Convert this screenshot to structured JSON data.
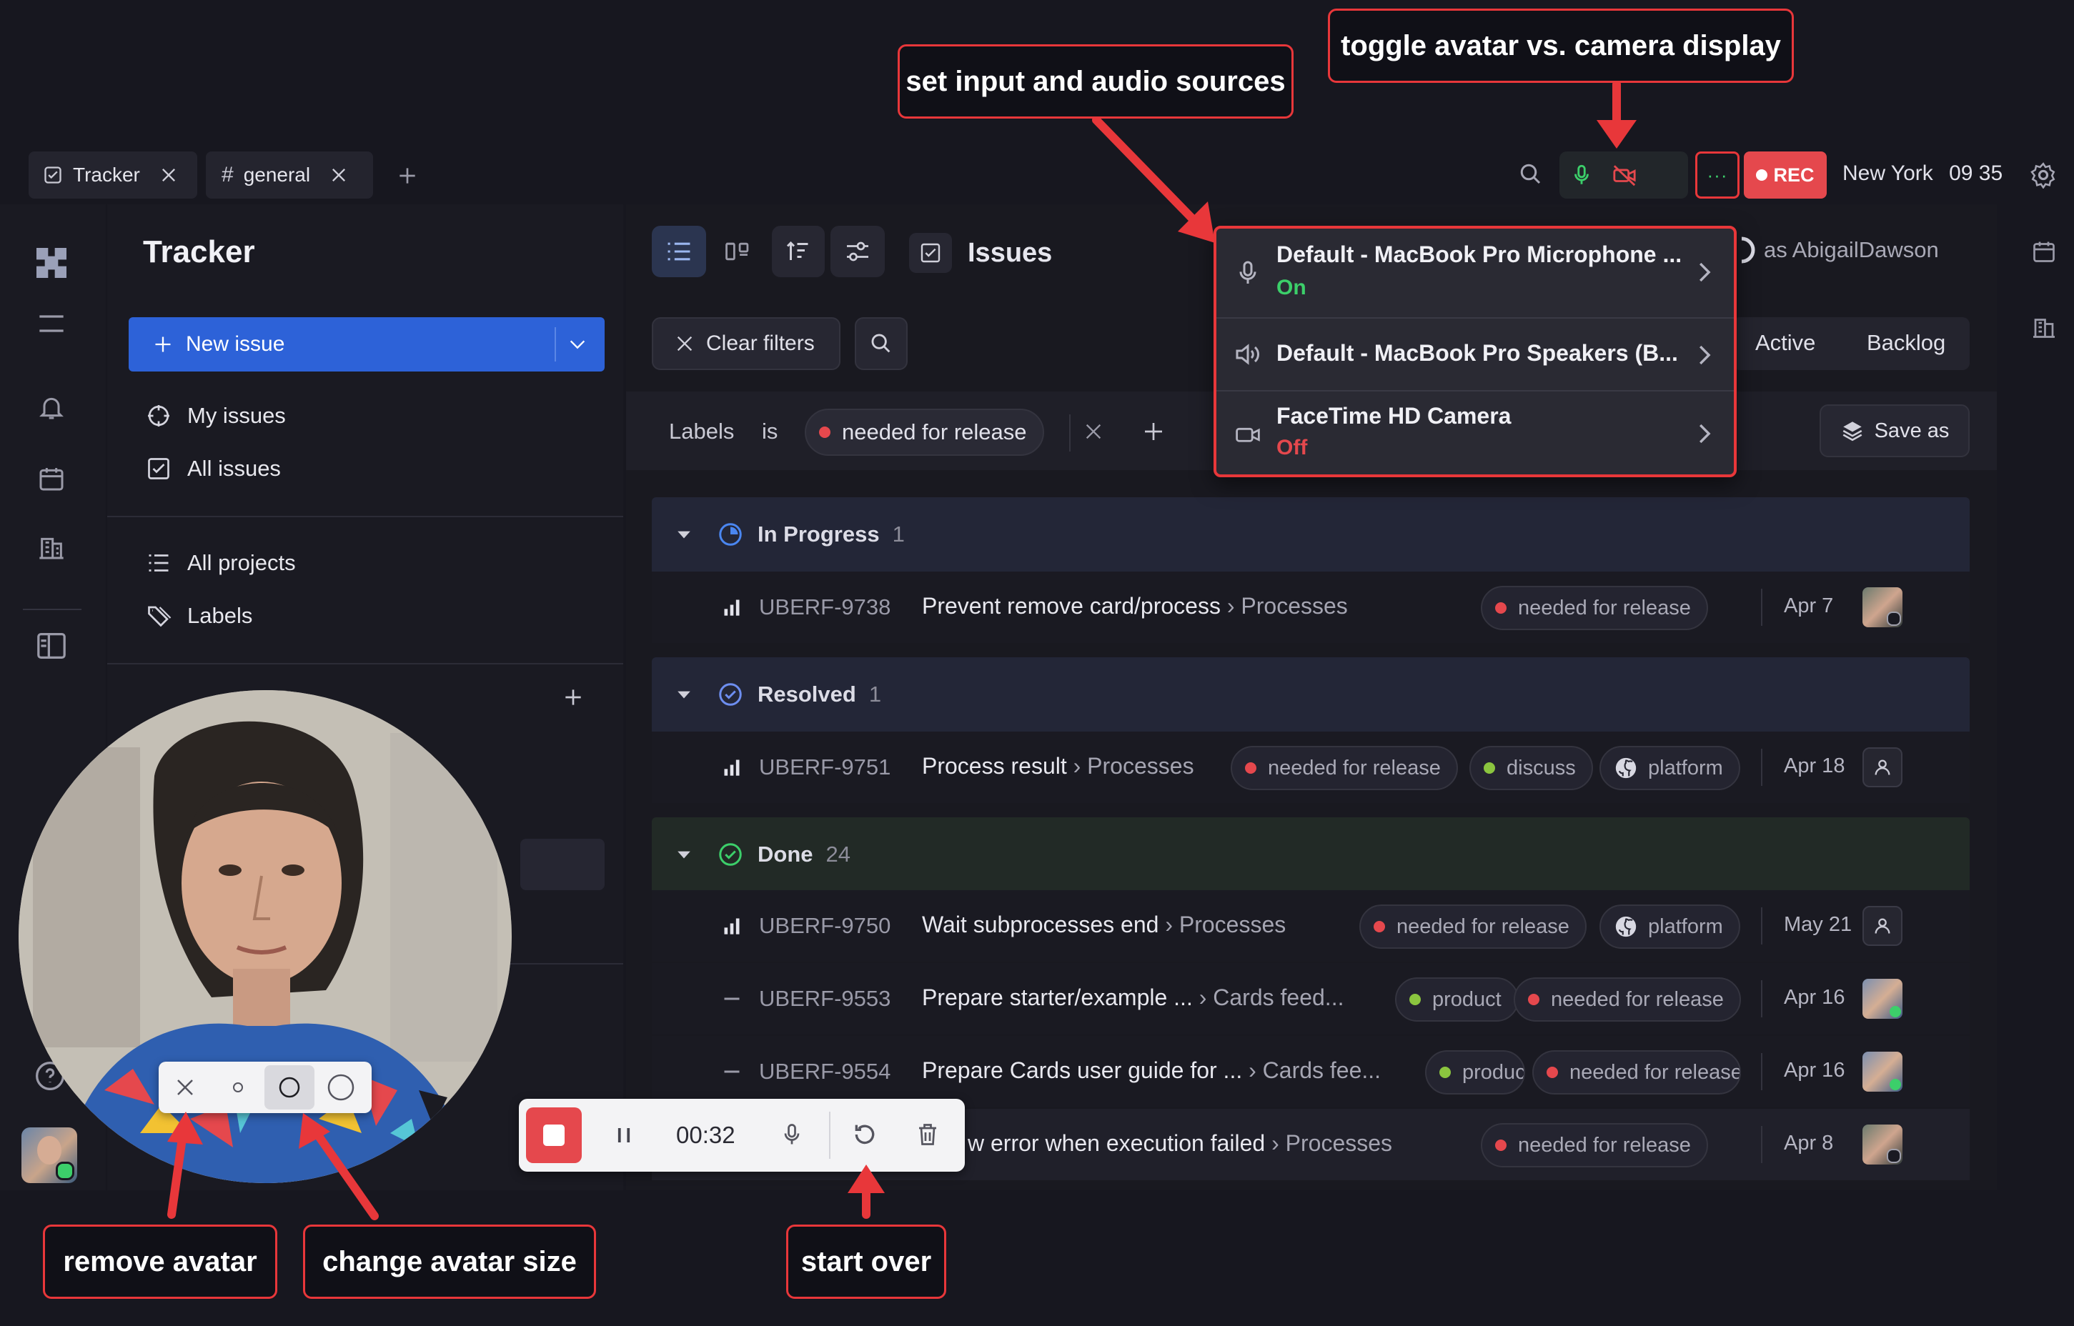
{
  "tabs": [
    {
      "label": "Tracker",
      "icon": "checkbox-icon"
    },
    {
      "label": "general",
      "icon": "hash-icon"
    }
  ],
  "topbar": {
    "rec_label": "REC",
    "city": "New York",
    "time": "09 35"
  },
  "sidebar": {
    "title": "Tracker",
    "new_issue": "New issue",
    "nav": [
      {
        "label": "My issues"
      },
      {
        "label": "All issues"
      },
      {
        "label": "All projects"
      },
      {
        "label": "Labels"
      }
    ]
  },
  "toolbar": {
    "issues_title": "Issues",
    "clear_filters": "Clear filters",
    "view_as": "as AbigailDawson",
    "active_tab": "Active",
    "backlog_tab": "Backlog",
    "save_as": "Save as"
  },
  "filter": {
    "field": "Labels",
    "op": "is",
    "value": "needed for release"
  },
  "colors": {
    "red": "#e5484d",
    "green": "#3ccf6a",
    "lime": "#8bc53f",
    "blue": "#2d62d8",
    "accent_blue": "#4a86f0"
  },
  "groups": [
    {
      "name": "In Progress",
      "count": "1",
      "status_color": "#4a86f0"
    },
    {
      "name": "Resolved",
      "count": "1",
      "status_color": "#6d8ef0"
    },
    {
      "name": "Done",
      "count": "24",
      "status_color": "#3ccf6a"
    }
  ],
  "issues": [
    {
      "id": "UBERF-9738",
      "title": "Prevent remove card/process",
      "sub": "› Processes",
      "labels": [
        "needed for release"
      ],
      "date": "Apr 7"
    },
    {
      "id": "UBERF-9751",
      "title": "Process result",
      "sub": "› Processes",
      "labels": [
        "needed for release",
        "discuss",
        "platform"
      ],
      "date": "Apr 18"
    },
    {
      "id": "UBERF-9750",
      "title": "Wait subprocesses end",
      "sub": "› Processes",
      "labels": [
        "needed for release",
        "platform"
      ],
      "date": "May 21"
    },
    {
      "id": "UBERF-9553",
      "title": "Prepare starter/example ...",
      "sub": "› Cards feed...",
      "labels": [
        "product",
        "needed for release"
      ],
      "date": "Apr 16"
    },
    {
      "id": "UBERF-9554",
      "title": "Prepare Cards user guide for ...",
      "sub": "› Cards fee...",
      "labels": [
        "product",
        "needed for release"
      ],
      "date": "Apr 16"
    },
    {
      "id": "",
      "title": "w error when execution failed",
      "sub": "› Processes",
      "labels": [
        "needed for release"
      ],
      "date": "Apr 8"
    }
  ],
  "device_menu": [
    {
      "title": "Default - MacBook Pro Microphone ...",
      "state": "On",
      "icon": "microphone-icon"
    },
    {
      "title": "Default - MacBook Pro Speakers (B...",
      "state": "",
      "icon": "speaker-icon"
    },
    {
      "title": "FaceTime HD Camera",
      "state": "Off",
      "icon": "camera-icon"
    }
  ],
  "recorder": {
    "timer": "00:32"
  },
  "callouts": {
    "input_sources": "set input and audio sources",
    "toggle_avatar": "toggle avatar vs. camera display",
    "remove_avatar": "remove avatar",
    "change_size": "change avatar size",
    "start_over": "start over"
  }
}
